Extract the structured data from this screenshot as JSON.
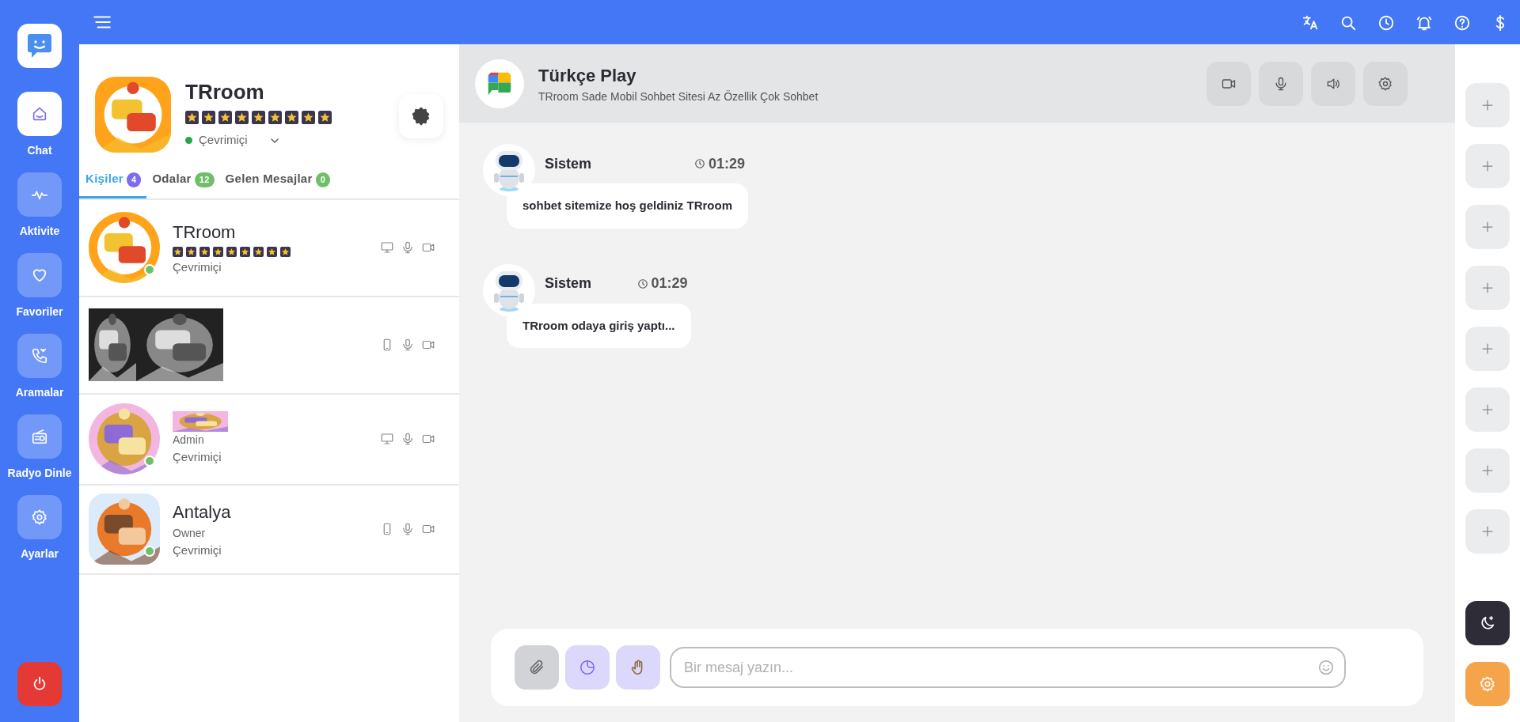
{
  "nav": {
    "items": [
      {
        "label": "Chat",
        "selected": true
      },
      {
        "label": "Aktivite",
        "selected": false
      },
      {
        "label": "Favoriler",
        "selected": false
      },
      {
        "label": "Aramalar",
        "selected": false
      },
      {
        "label": "Radyo Dinle",
        "selected": false
      },
      {
        "label": "Ayarlar",
        "selected": false
      }
    ]
  },
  "profile": {
    "name": "TRroom",
    "stars": 9,
    "status": "Çevrimiçi",
    "online": true
  },
  "tabs": [
    {
      "label": "Kişiler",
      "count": "4",
      "selected": true,
      "color": "#7b6cf0"
    },
    {
      "label": "Odalar",
      "count": "12",
      "selected": false,
      "color": "#6fbf6a"
    },
    {
      "label": "Gelen Mesajlar",
      "count": "0",
      "selected": false,
      "color": "#6fbf6a"
    }
  ],
  "contacts": [
    {
      "kind": "text",
      "name": "TRroom",
      "stars": 9,
      "status": "Çevrimiçi",
      "mobile": false,
      "online": true
    },
    {
      "kind": "banner",
      "mobile": true,
      "online": false
    },
    {
      "kind": "banner",
      "role": "Admin",
      "status": "Çevrimiçi",
      "mobile": false,
      "online": true
    },
    {
      "kind": "text",
      "name": "Antalya",
      "role": "Owner",
      "status": "Çevrimiçi",
      "mobile": true,
      "online": true
    }
  ],
  "chat": {
    "title": "Türkçe Play",
    "subtitle": "TRroom Sade Mobil Sohbet Sitesi Az Özellik Çok Sohbet",
    "messages": [
      {
        "author": "Sistem",
        "time": "01:29",
        "text": "sohbet sitemize hoş geldiniz TRroom"
      },
      {
        "author": "Sistem",
        "time": "01:29",
        "text": "TRroom odaya giriş yaptı..."
      }
    ]
  },
  "composer": {
    "placeholder": "Bir mesaj yazın..."
  },
  "quick_slots": [
    {
      "kind": "add"
    },
    {
      "kind": "add"
    },
    {
      "kind": "add"
    },
    {
      "kind": "add"
    },
    {
      "kind": "add"
    },
    {
      "kind": "add"
    },
    {
      "kind": "add"
    },
    {
      "kind": "add"
    }
  ]
}
